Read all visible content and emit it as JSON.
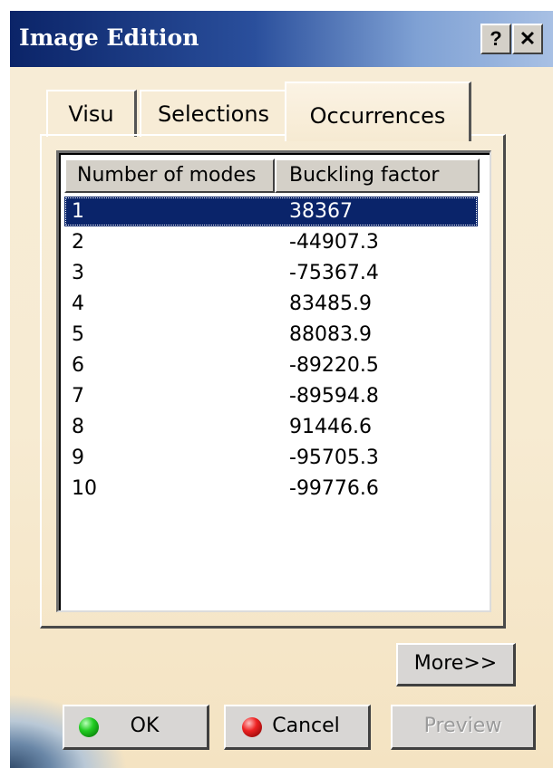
{
  "window": {
    "title": "Image Edition",
    "help_label": "?",
    "close_label": "✕"
  },
  "tabs": [
    {
      "label": "Visu"
    },
    {
      "label": "Selections"
    },
    {
      "label": "Occurrences",
      "active": true
    }
  ],
  "table": {
    "columns": [
      "Number of modes",
      "Buckling factor"
    ],
    "rows": [
      {
        "mode": "1",
        "factor": "38367",
        "selected": true
      },
      {
        "mode": "2",
        "factor": "-44907.3"
      },
      {
        "mode": "3",
        "factor": "-75367.4"
      },
      {
        "mode": "4",
        "factor": "83485.9"
      },
      {
        "mode": "5",
        "factor": "88083.9"
      },
      {
        "mode": "6",
        "factor": "-89220.5"
      },
      {
        "mode": "7",
        "factor": "-89594.8"
      },
      {
        "mode": "8",
        "factor": "91446.6"
      },
      {
        "mode": "9",
        "factor": "-95705.3"
      },
      {
        "mode": "10",
        "factor": "-99776.6"
      }
    ]
  },
  "buttons": {
    "more": "More>>",
    "ok": "OK",
    "cancel": "Cancel",
    "preview": "Preview"
  },
  "colors": {
    "title_bar": "#0b2468",
    "selection": "#0a246a",
    "dialog_bg": "#f7ebd2"
  }
}
